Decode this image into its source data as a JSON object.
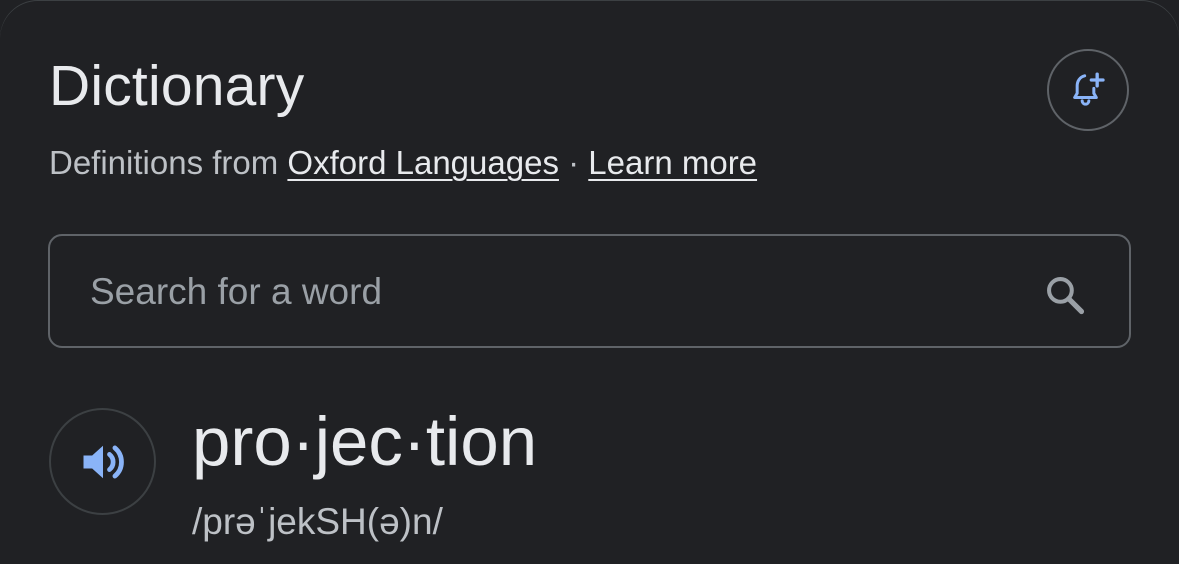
{
  "dictionary": {
    "title": "Dictionary",
    "source_prefix": "Definitions from ",
    "source_link": "Oxford Languages",
    "separator": " · ",
    "learn_more": "Learn more",
    "alert_icon": "bell-plus-icon"
  },
  "search": {
    "placeholder": "Search for a word",
    "value": "",
    "icon": "search-icon"
  },
  "entry": {
    "headword": "pro·jec·tion",
    "phonetic": "/prəˈjekSH(ə)n/",
    "audio_icon": "speaker-icon"
  },
  "colors": {
    "background": "#202124",
    "text": "#e8eaed",
    "secondary_text": "#bdc1c6",
    "accent": "#8ab4f8",
    "border": "#5f6368"
  }
}
